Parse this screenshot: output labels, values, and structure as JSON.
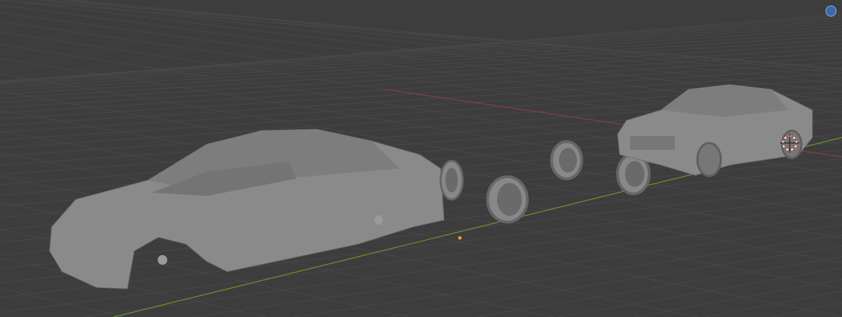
{
  "viewport": {
    "background": "#3d3d3d",
    "grid_color": "#4a4a4a",
    "x_axis_color": "#8a3b45",
    "y_axis_color": "#6b9a2b",
    "origin_color": "#f0a020",
    "model_color": "#8c8c8c"
  },
  "objects": [
    "car-body-detached",
    "wheel",
    "wheel",
    "wheel",
    "wheel",
    "car-complete"
  ]
}
